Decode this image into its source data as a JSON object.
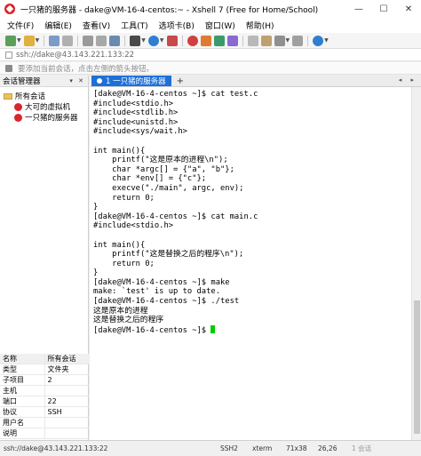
{
  "window": {
    "title": "一只猪的服务器 - dake@VM-16-4-centos:~ - Xshell 7 (Free for Home/School)",
    "minimize": "—",
    "maximize": "☐",
    "close": "✕"
  },
  "menu": [
    "文件(F)",
    "编辑(E)",
    "查看(V)",
    "工具(T)",
    "选项卡(B)",
    "窗口(W)",
    "帮助(H)"
  ],
  "address": {
    "value": "ssh://dake@43.143.221.133:22"
  },
  "hint": {
    "text": "要添加当前会话，点击左侧的箭头按钮。"
  },
  "session_manager": {
    "title": "会话管理器",
    "header_buttons": "▾ ✕",
    "root": "所有会话",
    "children": [
      "大可的虚拟机",
      "一只猪的服务器"
    ]
  },
  "properties": {
    "header": [
      "名称",
      "所有会话"
    ],
    "rows": [
      [
        "类型",
        "文件夹"
      ],
      [
        "子项目",
        "2"
      ],
      [
        "主机",
        ""
      ],
      [
        "端口",
        "22"
      ],
      [
        "协议",
        "SSH"
      ],
      [
        "用户名",
        ""
      ],
      [
        "说明",
        ""
      ]
    ]
  },
  "tabs": [
    {
      "label": "1 一只猪的服务器"
    }
  ],
  "tab_add": "+",
  "tab_nav": "◂ ▸",
  "terminal_lines": [
    "[dake@VM-16-4-centos ~]$ cat test.c",
    "#include<stdio.h>",
    "#include<stdlib.h>",
    "#include<unistd.h>",
    "#include<sys/wait.h>",
    "",
    "int main(){",
    "    printf(\"这是原本的进程\\n\");",
    "    char *argc[] = {\"a\", \"b\"};",
    "    char *env[] = {\"c\"};",
    "    execve(\"./main\", argc, env);",
    "    return 0;",
    "}",
    "[dake@VM-16-4-centos ~]$ cat main.c",
    "#include<stdio.h>",
    "",
    "int main(){",
    "    printf(\"这是替换之后的程序\\n\");",
    "    return 0;",
    "}",
    "[dake@VM-16-4-centos ~]$ make",
    "make: `test' is up to date.",
    "[dake@VM-16-4-centos ~]$ ./test",
    "这是原本的进程",
    "这是替换之后的程序"
  ],
  "prompt_line": "[dake@VM-16-4-centos ~]$ ",
  "status": {
    "address": "ssh://dake@43.143.221.133:22",
    "protocol": "SSH2",
    "terminal": "xterm",
    "size": "71x38",
    "position": "26,26",
    "sessions": "1 会话"
  }
}
